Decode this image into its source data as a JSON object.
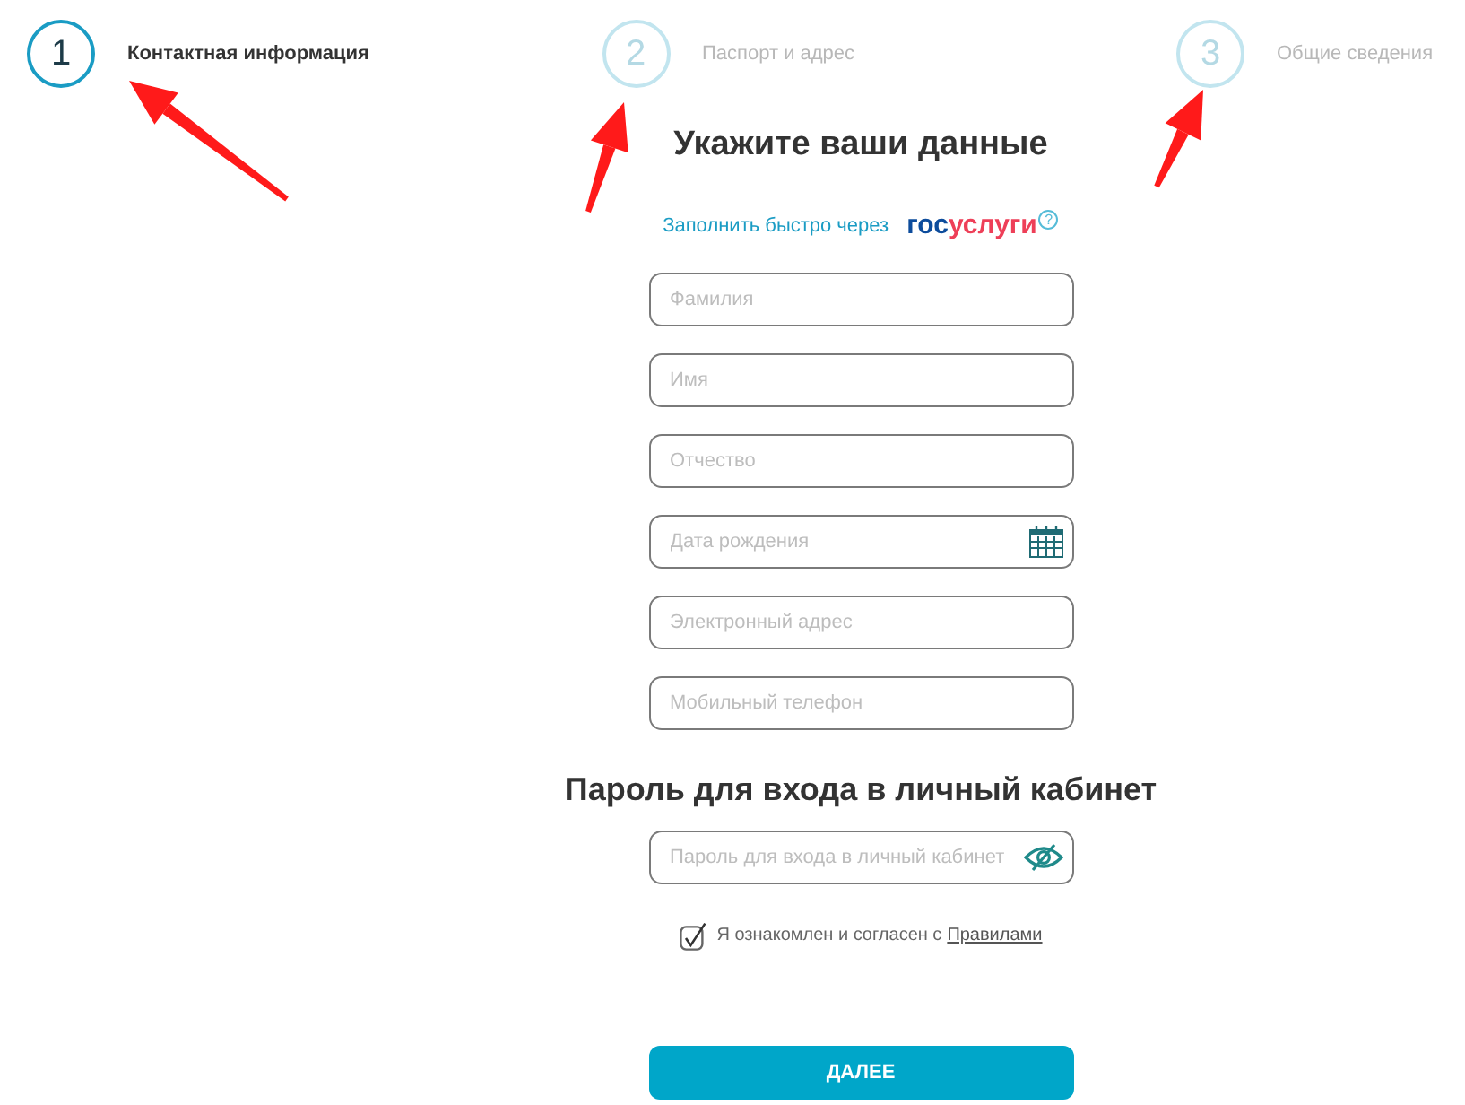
{
  "steps": [
    {
      "number": "1",
      "label": "Контактная информация",
      "selected": true
    },
    {
      "number": "2",
      "label": "Паспорт и адрес",
      "selected": false
    },
    {
      "number": "3",
      "label": "Общие сведения",
      "selected": false
    }
  ],
  "title": "Укажите ваши данные",
  "gosuslugi": {
    "text": "Заполнить быстро через",
    "logo_part_1": "гос",
    "logo_part_2": "услуги",
    "help": "?"
  },
  "fields": [
    {
      "kind": "text",
      "placeholder": "Фамилия"
    },
    {
      "kind": "text",
      "placeholder": "Имя"
    },
    {
      "kind": "text",
      "placeholder": "Отчество"
    },
    {
      "kind": "date",
      "placeholder": "Дата рождения"
    },
    {
      "kind": "text",
      "placeholder": "Электронный адрес"
    },
    {
      "kind": "text",
      "placeholder": "Мобильный телефон"
    }
  ],
  "password_section": {
    "title": "Пароль для входа в личный кабинет",
    "field": {
      "kind": "password",
      "placeholder": "Пароль для входа в личный кабинет"
    }
  },
  "consent": {
    "checked": true,
    "text": "Я ознакомлен и согласен с",
    "link": "Правилами"
  },
  "submit_button": "ДАЛЕЕ"
}
